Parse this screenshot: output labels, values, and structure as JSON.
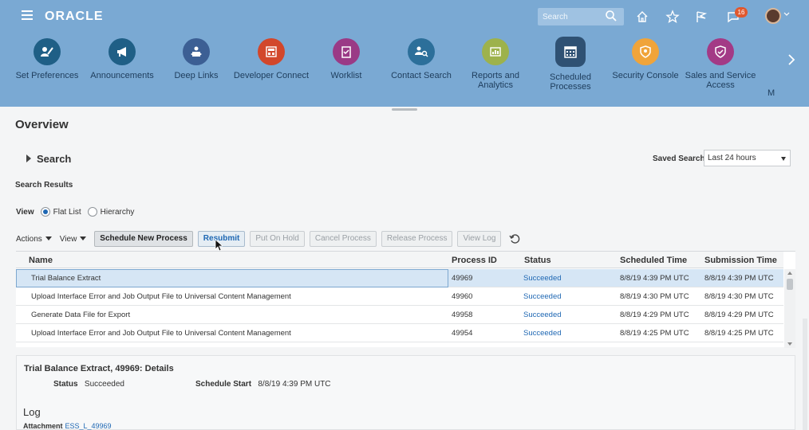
{
  "header": {
    "logo": "ORACLE",
    "search_placeholder": "Search",
    "notifications_count": "16"
  },
  "springboard": {
    "apps": [
      {
        "label": "Set Preferences",
        "color": "#1f5f86",
        "icon": "preferences-icon"
      },
      {
        "label": "Announcements",
        "color": "#1f5f86",
        "icon": "megaphone-icon"
      },
      {
        "label": "Deep Links",
        "color": "#3c5f94",
        "icon": "deep-links-icon"
      },
      {
        "label": "Developer Connect",
        "color": "#d2472b",
        "icon": "developer-connect-icon"
      },
      {
        "label": "Worklist",
        "color": "#9a3a86",
        "icon": "worklist-icon"
      },
      {
        "label": "Contact Search",
        "color": "#2c6f9a",
        "icon": "contact-search-icon"
      },
      {
        "label": "Reports and Analytics",
        "color": "#9db24c",
        "icon": "reports-icon"
      },
      {
        "label": "Scheduled Processes",
        "color": "#2f5173",
        "icon": "calendar-icon"
      },
      {
        "label": "Security Console",
        "color": "#f0a43a",
        "icon": "shield-icon"
      },
      {
        "label": "Sales and Service Access",
        "color": "#a33a86",
        "icon": "shield-check-icon"
      }
    ],
    "partial_label": "M"
  },
  "overview": {
    "title": "Overview",
    "search_label": "Search",
    "saved_search_label": "Saved Search",
    "saved_search_value": "Last 24 hours",
    "results_title": "Search Results",
    "view_label": "View",
    "view_options": [
      "Flat List",
      "Hierarchy"
    ],
    "view_selected": "Flat List"
  },
  "toolbar": {
    "actions": "Actions",
    "view": "View",
    "buttons": [
      "Schedule New Process",
      "Resubmit",
      "Put On Hold",
      "Cancel Process",
      "Release Process",
      "View Log"
    ]
  },
  "table": {
    "columns": [
      "Name",
      "Process ID",
      "Status",
      "Scheduled Time",
      "Submission Time"
    ],
    "rows": [
      {
        "name": "Trial Balance Extract",
        "id": "49969",
        "status": "Succeeded",
        "scheduled": "8/8/19 4:39 PM UTC",
        "submitted": "8/8/19 4:39 PM UTC"
      },
      {
        "name": "Upload Interface Error and Job Output File to Universal Content Management",
        "id": "49960",
        "status": "Succeeded",
        "scheduled": "8/8/19 4:30 PM UTC",
        "submitted": "8/8/19 4:30 PM UTC"
      },
      {
        "name": "Generate Data File for Export",
        "id": "49958",
        "status": "Succeeded",
        "scheduled": "8/8/19 4:29 PM UTC",
        "submitted": "8/8/19 4:29 PM UTC"
      },
      {
        "name": "Upload Interface Error and Job Output File to Universal Content Management",
        "id": "49954",
        "status": "Succeeded",
        "scheduled": "8/8/19 4:25 PM UTC",
        "submitted": "8/8/19 4:25 PM UTC"
      }
    ]
  },
  "details": {
    "title": "Trial Balance Extract, 49969: Details",
    "status_label": "Status",
    "status_value": "Succeeded",
    "schedule_start_label": "Schedule Start",
    "schedule_start_value": "8/8/19 4:39 PM UTC",
    "log_label": "Log",
    "attachment_label": "Attachment",
    "attachment_value": "ESS_L_49969"
  }
}
